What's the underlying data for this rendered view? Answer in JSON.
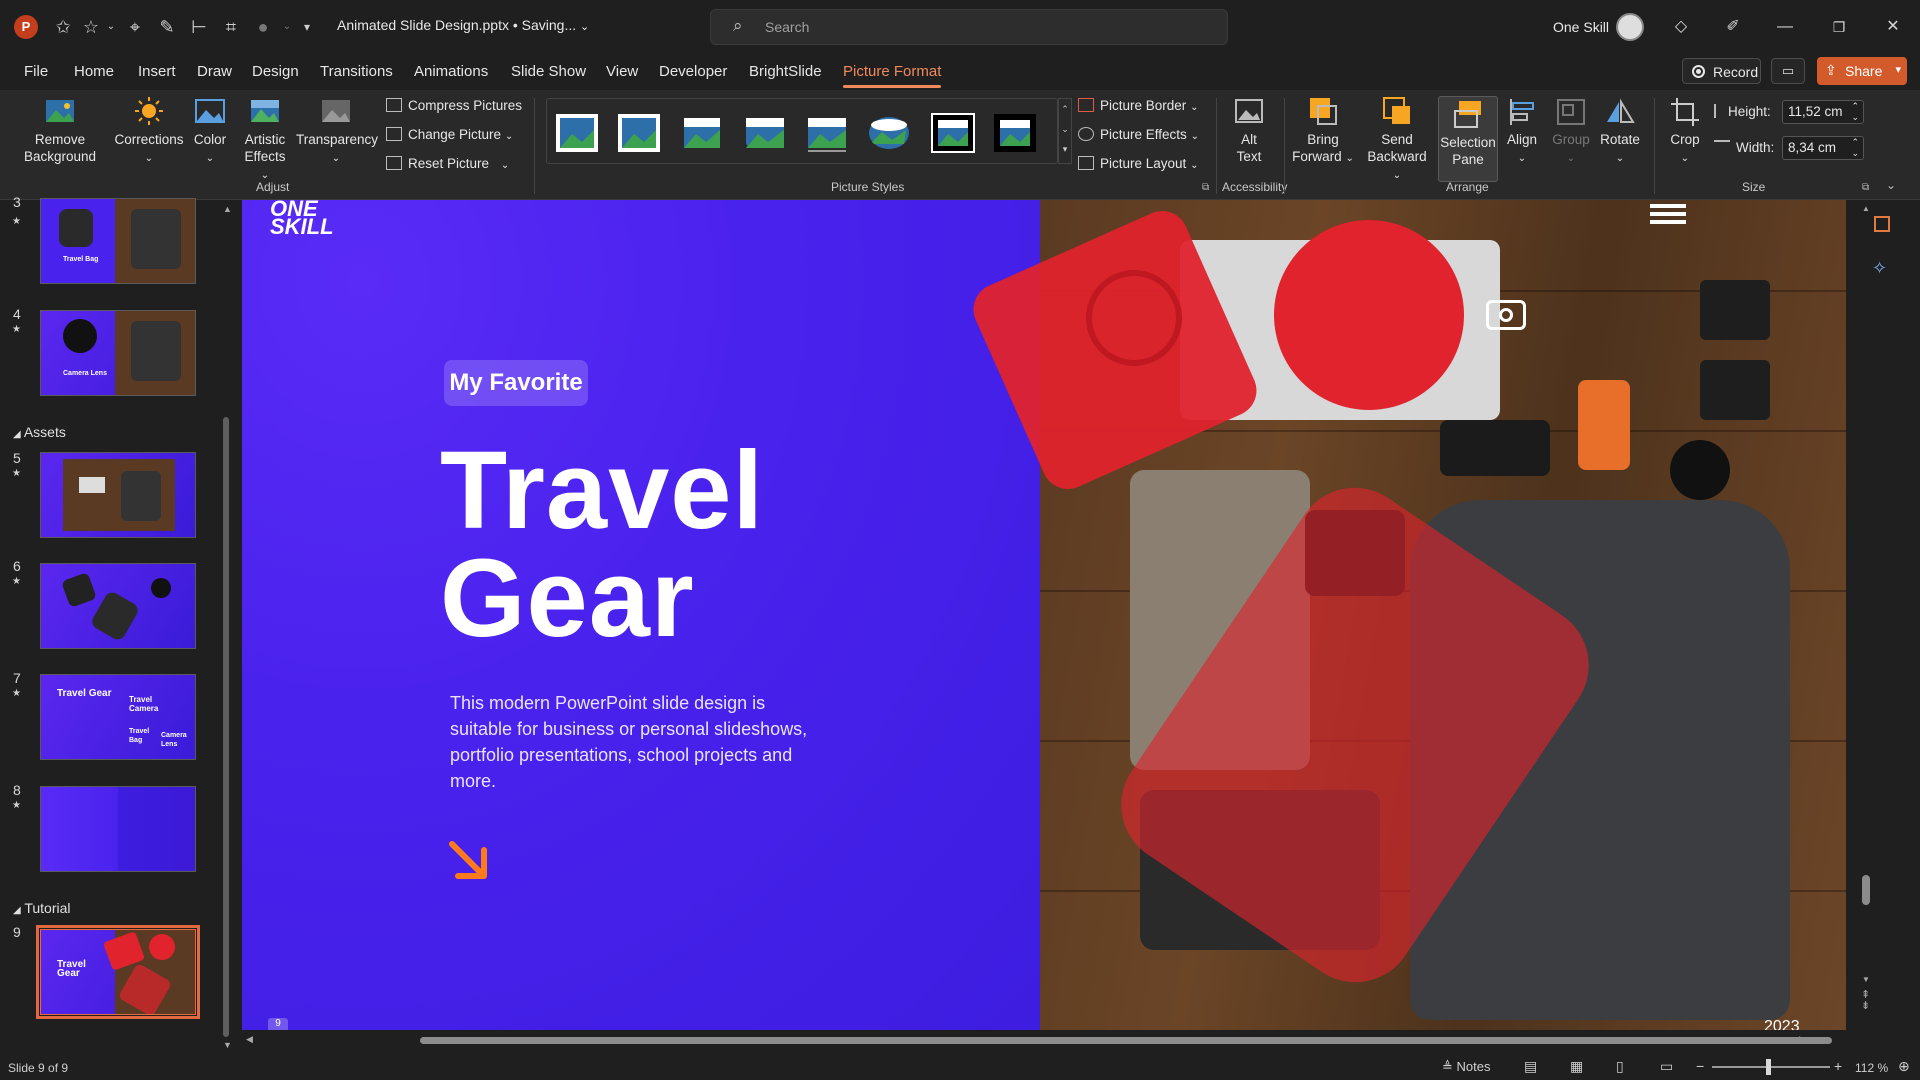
{
  "titlebar": {
    "document_title": "Animated Slide Design.pptx • Saving...",
    "search_placeholder": "Search",
    "user_name": "One Skill"
  },
  "menu": {
    "tabs": [
      "File",
      "Home",
      "Insert",
      "Draw",
      "Design",
      "Transitions",
      "Animations",
      "Slide Show",
      "View",
      "Developer",
      "BrightSlide",
      "Picture Format"
    ],
    "active_tab": "Picture Format",
    "record_label": "Record",
    "share_label": "Share"
  },
  "ribbon": {
    "adjust": {
      "remove_background_1": "Remove",
      "remove_background_2": "Background",
      "corrections": "Corrections",
      "color": "Color",
      "artistic_effects_1": "Artistic",
      "artistic_effects_2": "Effects",
      "transparency": "Transparency",
      "compress_pictures": "Compress Pictures",
      "change_picture": "Change Picture",
      "reset_picture": "Reset Picture",
      "group_label": "Adjust"
    },
    "picture_styles": {
      "group_label": "Picture Styles",
      "picture_border": "Picture Border",
      "picture_effects": "Picture Effects",
      "picture_layout": "Picture Layout"
    },
    "accessibility": {
      "alt_text_1": "Alt",
      "alt_text_2": "Text",
      "group_label": "Accessibility"
    },
    "arrange": {
      "bring_forward_1": "Bring",
      "bring_forward_2": "Forward",
      "send_backward_1": "Send",
      "send_backward_2": "Backward",
      "selection_pane_1": "Selection",
      "selection_pane_2": "Pane",
      "align": "Align",
      "group": "Group",
      "rotate": "Rotate",
      "group_label": "Arrange"
    },
    "size": {
      "crop": "Crop",
      "height_label": "Height:",
      "height_value": "11,52 cm",
      "width_label": "Width:",
      "width_value": "8,34 cm",
      "group_label": "Size"
    }
  },
  "slides_panel": {
    "thumbnails": [
      {
        "num": "3",
        "caption": "Travel Bag"
      },
      {
        "num": "4",
        "caption": "Camera Lens"
      },
      {
        "num": "5",
        "caption": ""
      },
      {
        "num": "6",
        "caption": ""
      },
      {
        "num": "7",
        "caption": "Travel Gear"
      },
      {
        "num": "8",
        "caption": ""
      },
      {
        "num": "9",
        "caption": "Travel Gear"
      }
    ],
    "sections": [
      "Assets",
      "Tutorial"
    ],
    "thumb7_labels": [
      "Travel Camera",
      "Travel Bag",
      "Camera Lens"
    ]
  },
  "slide": {
    "logo_line1": "ONE",
    "logo_line2": "SKILL",
    "pill": "My Favorite",
    "title_line1": "Travel",
    "title_line2": "Gear",
    "description": "This modern PowerPoint slide design is suitable for business or personal slideshows, portfolio presentations, school projects and more.",
    "number": "9",
    "year": "2023"
  },
  "statusbar": {
    "slide_count": "Slide 9 of 9",
    "notes": "Notes",
    "zoom": "112 %"
  },
  "colors": {
    "accent": "#f08a5d",
    "share": "#d35b2b",
    "slide_purple": "#4a22ee",
    "red_overlay": "#e0232d"
  }
}
